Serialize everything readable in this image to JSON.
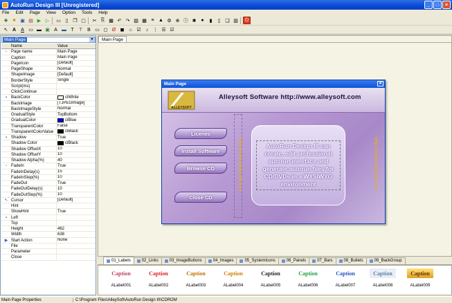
{
  "window": {
    "title": "AutoRun Design III [Unregistered]"
  },
  "menu": [
    "File",
    "Edit",
    "Page",
    "View",
    "Option",
    "Tools",
    "Help"
  ],
  "object_selector": {
    "value": "Main Page"
  },
  "props_header": {
    "name": "Name",
    "value": "Value"
  },
  "properties": [
    {
      "name": "Page name",
      "value": "Main Page",
      "icon": "▫"
    },
    {
      "name": "Caption",
      "value": "Main Page",
      "icon": ""
    },
    {
      "name": "PageIcon",
      "value": "[Default]",
      "icon": ""
    },
    {
      "name": "PageShape",
      "value": "Normal",
      "icon": ""
    },
    {
      "name": "ShapeImage",
      "value": "[Default]",
      "icon": ""
    },
    {
      "name": "BorderStyle",
      "value": "Single",
      "icon": ""
    },
    {
      "name": "Script(ms)",
      "value": "",
      "icon": ""
    },
    {
      "name": "ClickContinue",
      "value": "",
      "icon": ""
    },
    {
      "name": "BackColor",
      "value": "clWhite",
      "icon": "▪",
      "swatch": "#ffffff"
    },
    {
      "name": "BackImage",
      "value": "[TJPEGImage]",
      "icon": ""
    },
    {
      "name": "BackImageStyle",
      "value": "Normal",
      "icon": ""
    },
    {
      "name": "GradualStyle",
      "value": "TopBottom",
      "icon": ""
    },
    {
      "name": "GradualColor",
      "value": "clBlue",
      "icon": "",
      "swatch": "#0000ff"
    },
    {
      "name": "TransparentColor",
      "value": "False",
      "icon": ""
    },
    {
      "name": "TransparentColorValue",
      "value": "clBlack",
      "icon": "",
      "swatch": "#000000"
    },
    {
      "name": "Shadow",
      "value": "True",
      "icon": "▪"
    },
    {
      "name": "Shadow Color",
      "value": "clBlack",
      "icon": "",
      "swatch": "#000000"
    },
    {
      "name": "Shadow OffsetX",
      "value": "10",
      "icon": ""
    },
    {
      "name": "Shadow OffsetY",
      "value": "10",
      "icon": ""
    },
    {
      "name": "Shadow Alpha(%)",
      "value": "40",
      "icon": ""
    },
    {
      "name": "FadeIn",
      "value": "True",
      "icon": "▫"
    },
    {
      "name": "FadeInDelay(s)",
      "value": "15",
      "icon": ""
    },
    {
      "name": "FadeInStep(%)",
      "value": "10",
      "icon": ""
    },
    {
      "name": "FadeOut",
      "value": "True",
      "icon": ""
    },
    {
      "name": "FadeOutDelay(s)",
      "value": "10",
      "icon": ""
    },
    {
      "name": "FadeOutStep(%)",
      "value": "10",
      "icon": ""
    },
    {
      "name": "Cursor",
      "value": "[Default]",
      "icon": "↖"
    },
    {
      "name": "Hint",
      "value": "",
      "icon": ""
    },
    {
      "name": "ShowHint",
      "value": "True",
      "icon": ""
    },
    {
      "name": "Left",
      "value": "",
      "icon": "▪"
    },
    {
      "name": "Top",
      "value": "",
      "icon": ""
    },
    {
      "name": "Height",
      "value": "462",
      "icon": ""
    },
    {
      "name": "Width",
      "value": "638",
      "icon": ""
    },
    {
      "name": "Start Action",
      "value": "None",
      "icon": "▶"
    },
    {
      "name": "File",
      "value": "",
      "icon": ""
    },
    {
      "name": "Parameter",
      "value": "",
      "icon": ""
    },
    {
      "name": "Close",
      "value": "",
      "icon": ""
    }
  ],
  "workarea": {
    "tab": "Main Page"
  },
  "form": {
    "title": "Main Page",
    "header": "Alleysoft Software http://www.alleysoft.com",
    "logo_text": "ALLEYSOFT",
    "buttons": [
      "Licenes",
      "Install Software",
      "Browse CD",
      "Close CD"
    ],
    "vertical_text_1": "http://www.alleysoft.com",
    "vertical_text_2": "http://www.alleysoft.com",
    "body_text": "AutoRun Design III can create, edit professional autorun interface and generate autorun files for CD/DVDs in a WYSIWYG environment"
  },
  "bottom_tabs": [
    "01_Labels",
    "02_Links",
    "03_ImageButtons",
    "04_Images",
    "05_SystemIcons",
    "06_Panels",
    "07_Bars",
    "08_Bullets",
    "09_BackGroup"
  ],
  "gallery": [
    {
      "caption": "Caption",
      "label": "ALabel001",
      "color": "#c04060"
    },
    {
      "caption": "Caption",
      "label": "ALabel002",
      "color": "#e02020"
    },
    {
      "caption": "Caption",
      "label": "ALabel003",
      "color": "#c07000"
    },
    {
      "caption": "Caption",
      "label": "ALabel004",
      "color": "#d08000"
    },
    {
      "caption": "Caption",
      "label": "ALabel005",
      "color": "#202020"
    },
    {
      "caption": "Caption",
      "label": "ALabel006",
      "color": "#20a040"
    },
    {
      "caption": "Caption",
      "label": "ALabel007",
      "color": "#2050c0"
    },
    {
      "caption": "Caption",
      "label": "ALabel008",
      "color": "#6080a0"
    },
    {
      "caption": "Caption",
      "label": "ALabel009",
      "color": "#e0a000"
    }
  ],
  "status": {
    "left": "Main Page Properties",
    "path": "C:\\Program Files\\AlleySoft\\AutoRun Design III\\CDROM"
  }
}
